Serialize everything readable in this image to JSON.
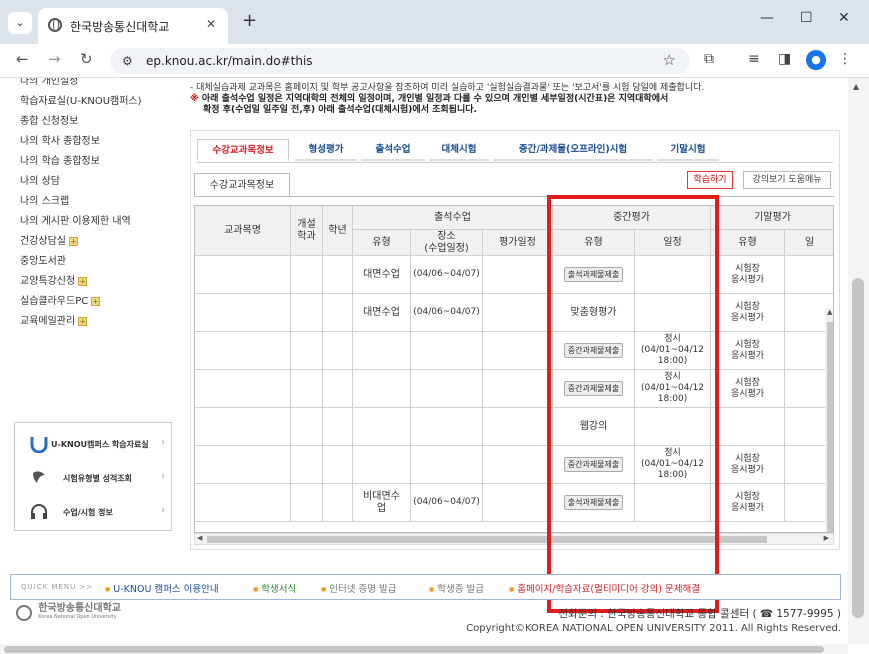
{
  "browser": {
    "tab_title": "한국방송통신대학교",
    "url": "ep.knou.ac.kr/main.do#this",
    "tab_dropdown_icon": "⌄",
    "new_tab_icon": "+",
    "close_icon": "✕",
    "minimize_icon": "—",
    "maximize_icon": "☐",
    "back_icon": "←",
    "forward_icon": "→",
    "reload_icon": "↻",
    "site_settings_icon": "⚙",
    "star_icon": "☆",
    "extensions_icon": "⧉",
    "media_icon": "≡",
    "sidepanel_icon": "◨",
    "profile_icon": "●",
    "menu_icon": "⋮"
  },
  "sidebar": {
    "items": [
      {
        "label": "나의 개인설정",
        "plus": false
      },
      {
        "label": "학습자료실(U-KNOU캠퍼스)",
        "plus": false
      },
      {
        "label": "종합 신청정보",
        "plus": false
      },
      {
        "label": "나의 학사 종합정보",
        "plus": false
      },
      {
        "label": "나의 학습 종합정보",
        "plus": false
      },
      {
        "label": "나의 상담",
        "plus": false
      },
      {
        "label": "나의 스크랩",
        "plus": false
      },
      {
        "label": "나의 게시판 이용제한 내역",
        "plus": false
      },
      {
        "label": "건강상담실",
        "plus": true
      },
      {
        "label": "중앙도서관",
        "plus": false
      },
      {
        "label": "교양특강신청",
        "plus": true
      },
      {
        "label": "실습클라우드PC",
        "plus": true
      },
      {
        "label": "교육메일관리",
        "plus": true
      }
    ],
    "plus_glyph": "+",
    "quick": [
      {
        "label": "U-KNOU캠퍼스 학습자료실",
        "icon": "u-knou-logo-icon"
      },
      {
        "label": "시험유형별 성적조회",
        "icon": "exam-icon"
      },
      {
        "label": "수업/시험 정보",
        "icon": "headset-icon"
      }
    ],
    "arrow": "›"
  },
  "notices": {
    "line1": "- 대체실습과제 교과목은 홈페이지 및 학부 공고사항을 참조하여 미리 실습하고 '실험실습결과물' 또는 '보고서'를 시험 당일에 제출합니다.",
    "line2_mark": "※",
    "line2": "아래 출석수업 일정은 지역대학의 전체의 일정이며, 개인별 일정과 다를 수 있으며 개인별 세부일정(시간표)은 지역대학에서",
    "line3": "확정 후(수업일 일주일 전,후) 아래 출석수업(대체시험)에서 조회됩니다."
  },
  "tabs": [
    "수강교과목정보",
    "형성평가",
    "출석수업",
    "대체시험",
    "중간/과제물(오프라인)시험",
    "기말시험"
  ],
  "subtab": "수강교과목정보",
  "buttons": {
    "study": "학습하기",
    "help": "강의보기 도움메뉴"
  },
  "table": {
    "headers": {
      "course": "교과목명",
      "open_dept": "개설\n학과",
      "year": "학년",
      "attendance": "출석수업",
      "att_type": "유형",
      "att_place": "장소\n(수업일정)",
      "att_eval": "평가일정",
      "midterm": "중간평가",
      "mid_type": "유형",
      "mid_date": "일정",
      "final": "기말평가",
      "fin_type": "유형",
      "fin_date": "일"
    },
    "rows": [
      {
        "att_type": "대면수업",
        "att_place": "(04/06~04/07)",
        "mid_type": "출석과제물제출",
        "mid_is_button": true,
        "mid_date": "",
        "fin_type": "시험장\n응시평가"
      },
      {
        "att_type": "대면수업",
        "att_place": "(04/06~04/07)",
        "mid_type": "맞춤형평가",
        "mid_is_button": false,
        "mid_date": "",
        "fin_type": "시험장\n응시평가"
      },
      {
        "att_type": "",
        "att_place": "",
        "mid_type": "중간과제물제출",
        "mid_is_button": true,
        "mid_date": "정시\n(04/01~04/12\n18:00)",
        "fin_type": "시험장\n응시평가"
      },
      {
        "att_type": "",
        "att_place": "",
        "mid_type": "중간과제물제출",
        "mid_is_button": true,
        "mid_date": "정시\n(04/01~04/12\n18:00)",
        "fin_type": "시험장\n응시평가"
      },
      {
        "att_type": "",
        "att_place": "",
        "mid_type": "웹강의",
        "mid_is_button": false,
        "mid_date": "",
        "fin_type": ""
      },
      {
        "att_type": "",
        "att_place": "",
        "mid_type": "중간과제물제출",
        "mid_is_button": true,
        "mid_date": "정시\n(04/01~04/12\n18:00)",
        "fin_type": "시험장\n응시평가"
      },
      {
        "att_type": "비대면수\n업",
        "att_place": "(04/06~04/07)",
        "mid_type": "출석과제물제출",
        "mid_is_button": true,
        "mid_date": "",
        "fin_type": "시험장\n응시평가"
      }
    ],
    "scroll_up": "▲",
    "scroll_left": "◀",
    "scroll_right": "▶"
  },
  "quick_menu": {
    "label": "QUICK MENU  >>",
    "items": [
      {
        "label": "U-KNOU 캠퍼스 이용안내",
        "color": "#1a4d9e"
      },
      {
        "label": "학생서식",
        "color": "#2f8a2f"
      },
      {
        "label": "인터넷 증명 발급",
        "color": "#777777"
      },
      {
        "label": "학생증 발급",
        "color": "#777777"
      },
      {
        "label": "홈페이지/학습자료(멀티미디어 강의) 문제해결",
        "color": "#d2232a"
      }
    ]
  },
  "footer": {
    "logo_name": "한국방송통신대학교",
    "logo_en": "Korea National Open University",
    "contact": "전화문의 : 한국방송통신대학교 통합 콜센터 ( ☎ 1577-9995 )",
    "copyright": "Copyright©KOREA NATIONAL OPEN UNIVERSITY 2011. All Rights Reserved."
  },
  "colors": {
    "highlight_box": "#e21b1b",
    "tab_active": "#d2232a",
    "tab_text": "#1a4d8f"
  }
}
